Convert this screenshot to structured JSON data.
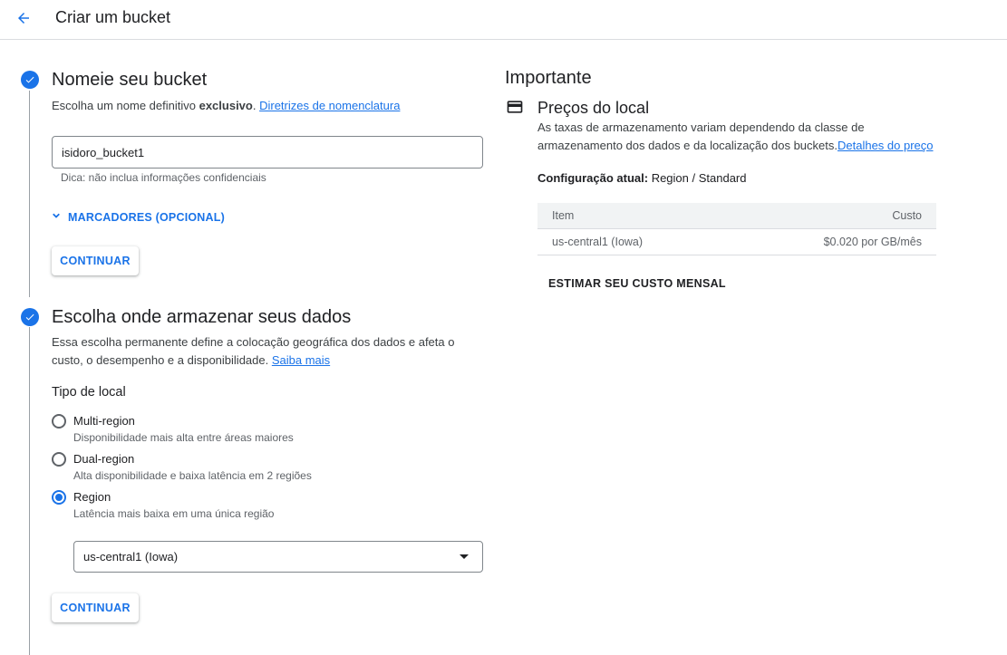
{
  "header": {
    "title": "Criar um bucket"
  },
  "step1": {
    "title": "Nomeie seu bucket",
    "desc_prefix": "Escolha um nome definitivo ",
    "desc_bold": "exclusivo",
    "desc_suffix": ". ",
    "link": "Diretrizes de nomenclatura",
    "input_value": "isidoro_bucket1",
    "hint": "Dica: não inclua informações confidenciais",
    "labels_toggle": "MARCADORES (OPCIONAL)",
    "continue": "CONTINUAR"
  },
  "step2": {
    "title": "Escolha onde armazenar seus dados",
    "desc_line1": "Essa escolha permanente define a colocação geográfica dos dados e afeta o",
    "desc_line2": "custo, o desempenho e a disponibilidade. ",
    "link": "Saiba mais",
    "location_type_label": "Tipo de local",
    "options": [
      {
        "label": "Multi-region",
        "desc": "Disponibilidade mais alta entre áreas maiores"
      },
      {
        "label": "Dual-region",
        "desc": "Alta disponibilidade e baixa latência em 2 regiões"
      },
      {
        "label": "Region",
        "desc": "Latência mais baixa em uma única região"
      }
    ],
    "selected_option": "Region",
    "region_value": "us-central1 (Iowa)",
    "continue": "CONTINUAR"
  },
  "side": {
    "title": "Importante",
    "pricing_title": "Preços do local",
    "pricing_desc_line1": "As taxas de armazenamento variam dependendo da classe de",
    "pricing_desc_line2": "armazenamento dos dados e da localização dos buckets.",
    "pricing_link": "Detalhes do preço",
    "config_label": "Configuração atual:",
    "config_value": " Region / Standard",
    "table": {
      "headers": [
        "Item",
        "Custo"
      ],
      "rows": [
        [
          "us-central1 (Iowa)",
          "$0.020 por GB/mês"
        ]
      ]
    },
    "estimate": "ESTIMAR SEU CUSTO MENSAL"
  },
  "colors": {
    "accent": "#1a73e8",
    "text": "#202124",
    "muted": "#5f6368"
  }
}
